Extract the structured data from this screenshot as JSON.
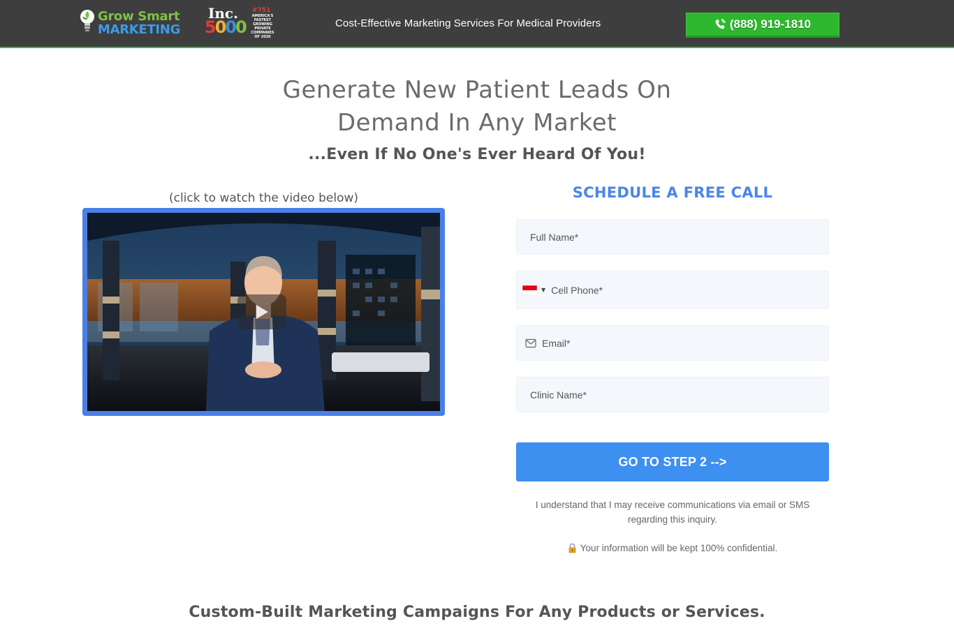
{
  "header": {
    "logo_line1": "Grow Smart",
    "logo_line2": "MARKETING",
    "inc_word": "Inc.",
    "inc_number_digits": [
      "5",
      "0",
      "0",
      "0"
    ],
    "inc_rank": "#751",
    "inc_subtitle": "AMERICA'S FASTEST GROWING PRIVATE COMPANIES OF 2020",
    "tagline": "Cost-Effective Marketing Services For Medical Providers",
    "phone_label": "(888) 919-1810",
    "phone_icon": "phone-icon"
  },
  "hero": {
    "headline_line1": "Generate New Patient Leads On",
    "headline_line2": "Demand In Any Market",
    "subheadline": "...Even If No One's Ever Heard Of You!"
  },
  "video": {
    "caption": "(click to watch the video below)",
    "play_icon": "play-icon"
  },
  "form": {
    "title": "SCHEDULE A FREE CALL",
    "full_name_placeholder": "Full Name*",
    "cell_phone_placeholder": "Cell Phone*",
    "email_placeholder": "Email*",
    "clinic_name_placeholder": "Clinic Name*",
    "country_flag": "indonesia-flag-icon",
    "submit_label": "GO TO STEP 2 -->",
    "consent_text": "I understand that I may receive communications via email or SMS regarding this inquiry.",
    "confidential_text": "Your information will be kept 100% confidential."
  },
  "section": {
    "heading": "Custom-Built Marketing Campaigns For Any Products or Services."
  },
  "colors": {
    "header_bg": "#3e3e3e",
    "header_accent": "#3ab54a",
    "phone_button": "#2eb82e",
    "form_title": "#4a86e8",
    "submit_button": "#3d8ff0",
    "video_border": "#4a7fe6"
  }
}
